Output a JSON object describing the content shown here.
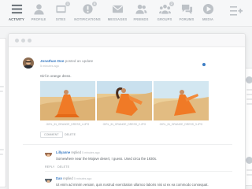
{
  "nav": {
    "items": [
      {
        "label": "ACTIVITY",
        "icon": "activity-icon",
        "active": true,
        "badge": ""
      },
      {
        "label": "PROFILE",
        "icon": "profile-icon",
        "active": false,
        "badge": ""
      },
      {
        "label": "SITES",
        "icon": "sites-icon",
        "active": false,
        "badge": "1"
      },
      {
        "label": "NOTIFICATIONS",
        "icon": "notifications-icon",
        "active": false,
        "badge": "8"
      },
      {
        "label": "MESSAGES",
        "icon": "messages-icon",
        "active": false,
        "badge": ""
      },
      {
        "label": "FRIENDS",
        "icon": "friends-icon",
        "active": false,
        "badge": ""
      },
      {
        "label": "GROUPS",
        "icon": "groups-icon",
        "active": false,
        "badge": "2"
      },
      {
        "label": "FORUMS",
        "icon": "forums-icon",
        "active": false,
        "badge": ""
      },
      {
        "label": "MEDIA",
        "icon": "media-icon",
        "active": false,
        "badge": ""
      }
    ]
  },
  "post": {
    "author": "Jonathan Doe",
    "action": "posted an update",
    "time": "5 minutes ago",
    "text": "Girl in orange dress.",
    "photos": [
      {
        "caption": "GIRL_IN_ORANGE_DRESS_4.JPG"
      },
      {
        "caption": "GIRL_IN_ORANGE_DRESS_2.JPG"
      },
      {
        "caption": "GIRL_IN_ORANGE_DRESS_3.JPG"
      }
    ],
    "comment_label": "COMMENT",
    "delete_label": "DELETE"
  },
  "comments": [
    {
      "author": "Lillyanne",
      "action": "replied",
      "time": "5 minutes ago",
      "text": "Somewhere near the Mojave desert, I guess. Used circa the 1930s.",
      "reply_label": "REPLY",
      "delete_label": "DELETE"
    },
    {
      "author": "Dan",
      "action": "replied",
      "time": "5 minutes ago",
      "text": "Ut enim ad minim veniam, quis nostrud exercitation ullamco laboris nisi ut ex ea commodo consequat."
    }
  ],
  "colors": {
    "link": "#3c7dc4",
    "dress": "#f07a26",
    "sand": "#e8c68f",
    "sky": "#cfe4ef"
  }
}
